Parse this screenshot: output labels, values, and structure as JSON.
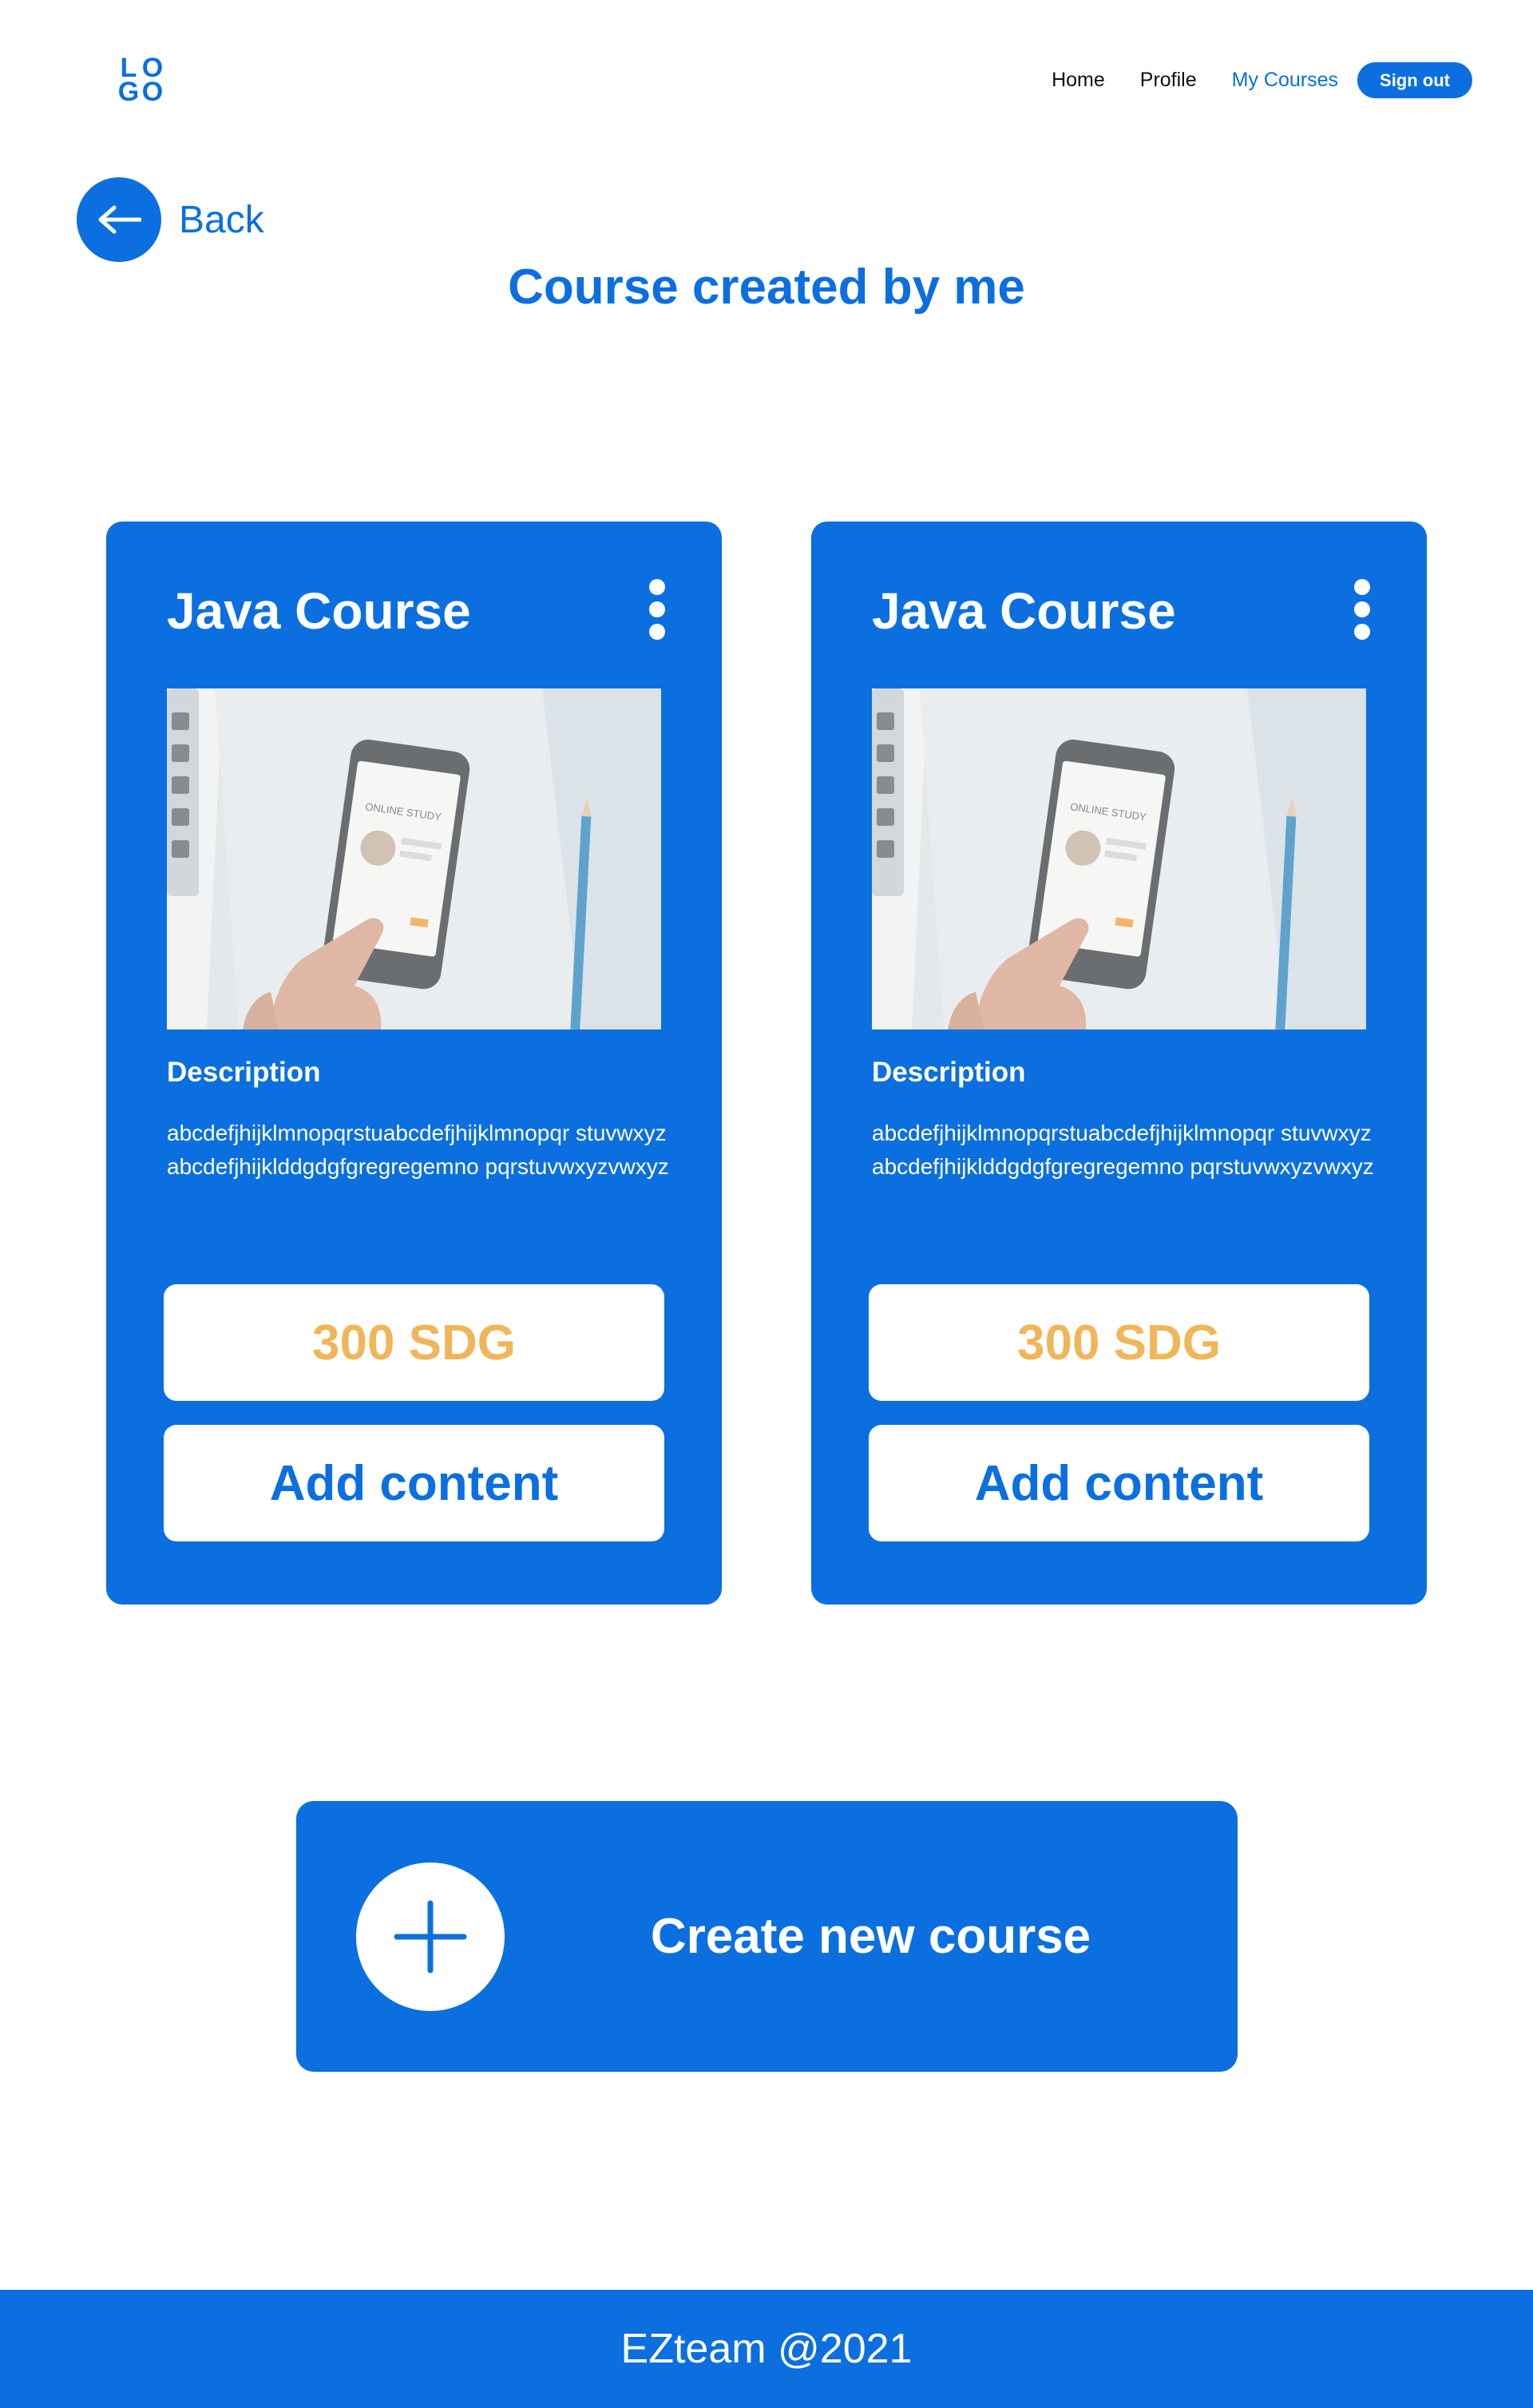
{
  "header": {
    "logo_letters": [
      "L",
      "O",
      "G",
      "O"
    ],
    "nav": [
      {
        "label": "Home",
        "active": false
      },
      {
        "label": "Profile",
        "active": false
      },
      {
        "label": "My Courses",
        "active": true
      }
    ],
    "signout_label": "Sign out"
  },
  "back_label": "Back",
  "page_title": "Course created by me",
  "cards": [
    {
      "title": "Java Course",
      "image_text": "ONLINE STUDY",
      "description_title": "Description",
      "description": "abcdefjhijklmnopqrstuabcdefjhijklmnopqr stuvwxyzabcdefjhijklddgdgfgregregemno pqrstuvwxyzvwxyz",
      "price": "300 SDG",
      "add_label": "Add content"
    },
    {
      "title": "Java Course",
      "image_text": "ONLINE STUDY",
      "description_title": "Description",
      "description": "abcdefjhijklmnopqrstuabcdefjhijklmnopqr stuvwxyzabcdefjhijklddgdgfgregregemno pqrstuvwxyzvwxyz",
      "price": "300 SDG",
      "add_label": "Add content"
    }
  ],
  "create_label": "Create new course",
  "footer_text": "EZteam @2021",
  "colors": {
    "primary": "#0b6fe0",
    "price": "#f0b65a",
    "white": "#ffffff"
  },
  "icons": {
    "back": "arrow-left-icon",
    "kebab": "more-vertical-icon",
    "create": "plus-icon"
  }
}
